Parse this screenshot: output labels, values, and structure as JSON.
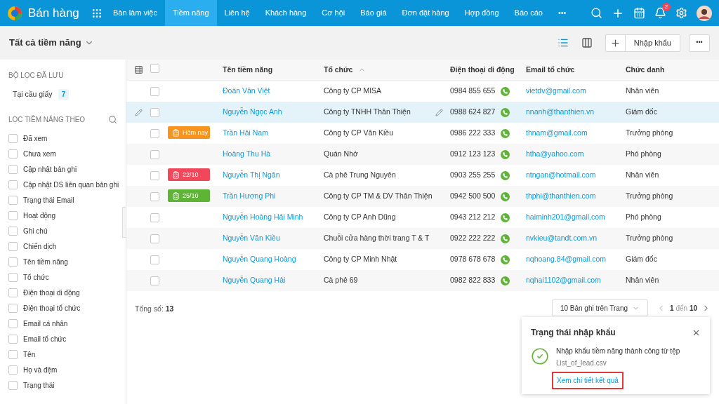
{
  "app": {
    "title": "Bán hàng",
    "notification_count": "2"
  },
  "nav": [
    {
      "label": "Bàn làm việc",
      "selected": false
    },
    {
      "label": "Tiềm năng",
      "selected": true
    },
    {
      "label": "Liên hệ",
      "selected": false
    },
    {
      "label": "Khách hàng",
      "selected": false
    },
    {
      "label": "Cơ hội",
      "selected": false
    },
    {
      "label": "Báo giá",
      "selected": false
    },
    {
      "label": "Đơn đặt hàng",
      "selected": false
    },
    {
      "label": "Hợp đồng",
      "selected": false
    },
    {
      "label": "Báo cáo",
      "selected": false
    },
    {
      "label": "•••",
      "selected": false
    }
  ],
  "view": {
    "title": "Tất cả tiềm năng",
    "import_button": "Nhập khẩu",
    "more_button": "•••"
  },
  "sidebar": {
    "saved_heading": "BỘ LỌC ĐÃ LƯU",
    "saved_filters": [
      {
        "label": "Tại cầu giấy",
        "count": "7"
      }
    ],
    "filter_heading": "LỌC TIỀM NĂNG THEO",
    "filters": [
      {
        "label": "Đã xem",
        "checked": false
      },
      {
        "label": "Chưa xem",
        "checked": false
      },
      {
        "label": "Cập nhật bản ghi",
        "checked": false
      },
      {
        "label": "Cập nhật DS liên quan bản ghi",
        "checked": false
      },
      {
        "label": "Trạng thái Email",
        "checked": false
      },
      {
        "label": "Hoạt động",
        "checked": false
      },
      {
        "label": "Ghi chú",
        "checked": false
      },
      {
        "label": "Chiến dịch",
        "checked": false
      },
      {
        "label": "Tên tiềm năng",
        "checked": false
      },
      {
        "label": "Tổ chức",
        "checked": false
      },
      {
        "label": "Điện thoại di động",
        "checked": false
      },
      {
        "label": "Điện thoại tổ chức",
        "checked": false
      },
      {
        "label": "Email cá nhân",
        "checked": false
      },
      {
        "label": "Email tổ chức",
        "checked": false
      },
      {
        "label": "Tên",
        "checked": false
      },
      {
        "label": "Họ và đệm",
        "checked": false
      },
      {
        "label": "Trạng thái",
        "checked": false
      }
    ]
  },
  "table": {
    "select_all_checked": false,
    "columns": [
      "Tên tiềm năng",
      "Tổ chức",
      "Điện thoại di động",
      "Email tổ chức",
      "Chức danh"
    ],
    "rows": [
      {
        "name": "Đoàn Văn Việt",
        "org": "Công ty CP MISA",
        "phone": "0984 855 655",
        "email": "vietdv@gmail.com",
        "title": "Nhân viên",
        "checked": false,
        "highlighted": false
      },
      {
        "name": "Nguyễn Ngọc Anh",
        "org": "Công ty TNHH Thân Thiện",
        "phone": "0988 624 827",
        "email": "nnanh@thanthien.vn",
        "title": "Giám đốc",
        "checked": false,
        "highlighted": true
      },
      {
        "name": "Trần Hải Nam",
        "org": "Công ty CP Văn Kiều",
        "phone": "0986 222 333",
        "email": "thnam@gmail.com",
        "title": "Trưởng phòng",
        "checked": false,
        "highlighted": false,
        "badge": {
          "label": "Hôm nay",
          "color": "#f7941d"
        }
      },
      {
        "name": "Hoàng Thu Hà",
        "org": "Quán Nhớ",
        "phone": "0912 123 123",
        "email": "htha@yahoo.com",
        "title": "Phó phòng",
        "checked": false,
        "highlighted": false
      },
      {
        "name": "Nguyễn Thị Ngân",
        "org": "Cà phê Trung Nguyên",
        "phone": "0903 255 255",
        "email": "ntngan@hotmail.com",
        "title": "Nhân viên",
        "checked": false,
        "highlighted": false,
        "badge": {
          "label": "22/10",
          "color": "#f0475a"
        }
      },
      {
        "name": "Trần Hương Phi",
        "org": "Công ty CP TM & DV Thân Thiện",
        "phone": "0942 500 500",
        "email": "thphi@thanthien.com",
        "title": "Trưởng phòng",
        "checked": false,
        "highlighted": false,
        "badge": {
          "label": "25/10",
          "color": "#5fb336"
        }
      },
      {
        "name": "Nguyễn Hoàng Hải Minh",
        "org": "Công ty CP Anh Dũng",
        "phone": "0943 212 212",
        "email": "haiminh201@gmail.com",
        "title": "Phó phòng",
        "checked": false,
        "highlighted": false
      },
      {
        "name": "Nguyễn Văn Kiều",
        "org": "Chuỗi cửa hàng thời trang T & T",
        "phone": "0922 222 222",
        "email": "nvkieu@tandt.com.vn",
        "title": "Trưởng phòng",
        "checked": false,
        "highlighted": false
      },
      {
        "name": "Nguyễn Quang Hoàng",
        "org": "Công ty CP Minh Nhật",
        "phone": "0978 678 678",
        "email": "nqhoang.84@gmail.com",
        "title": "Giám đốc",
        "checked": false,
        "highlighted": false
      },
      {
        "name": "Nguyễn Quang Hải",
        "org": "Cà phê 69",
        "phone": "0982 822 833",
        "email": "nqhai1102@gmail.com",
        "title": "Nhân viên",
        "checked": false,
        "highlighted": false
      }
    ]
  },
  "footer": {
    "total_label": "Tổng số:",
    "total": "13",
    "page_size": "10 Bản ghi trên Trang",
    "range_from": "1",
    "range_word": "đến",
    "range_to": "10"
  },
  "toast": {
    "title": "Trạng thái nhập khẩu",
    "message": "Nhập khẩu tiềm năng thành công từ tệp",
    "file": "List_of_lead.csv",
    "link": "Xem chi tiết kết quả",
    "link_outlined": true
  }
}
